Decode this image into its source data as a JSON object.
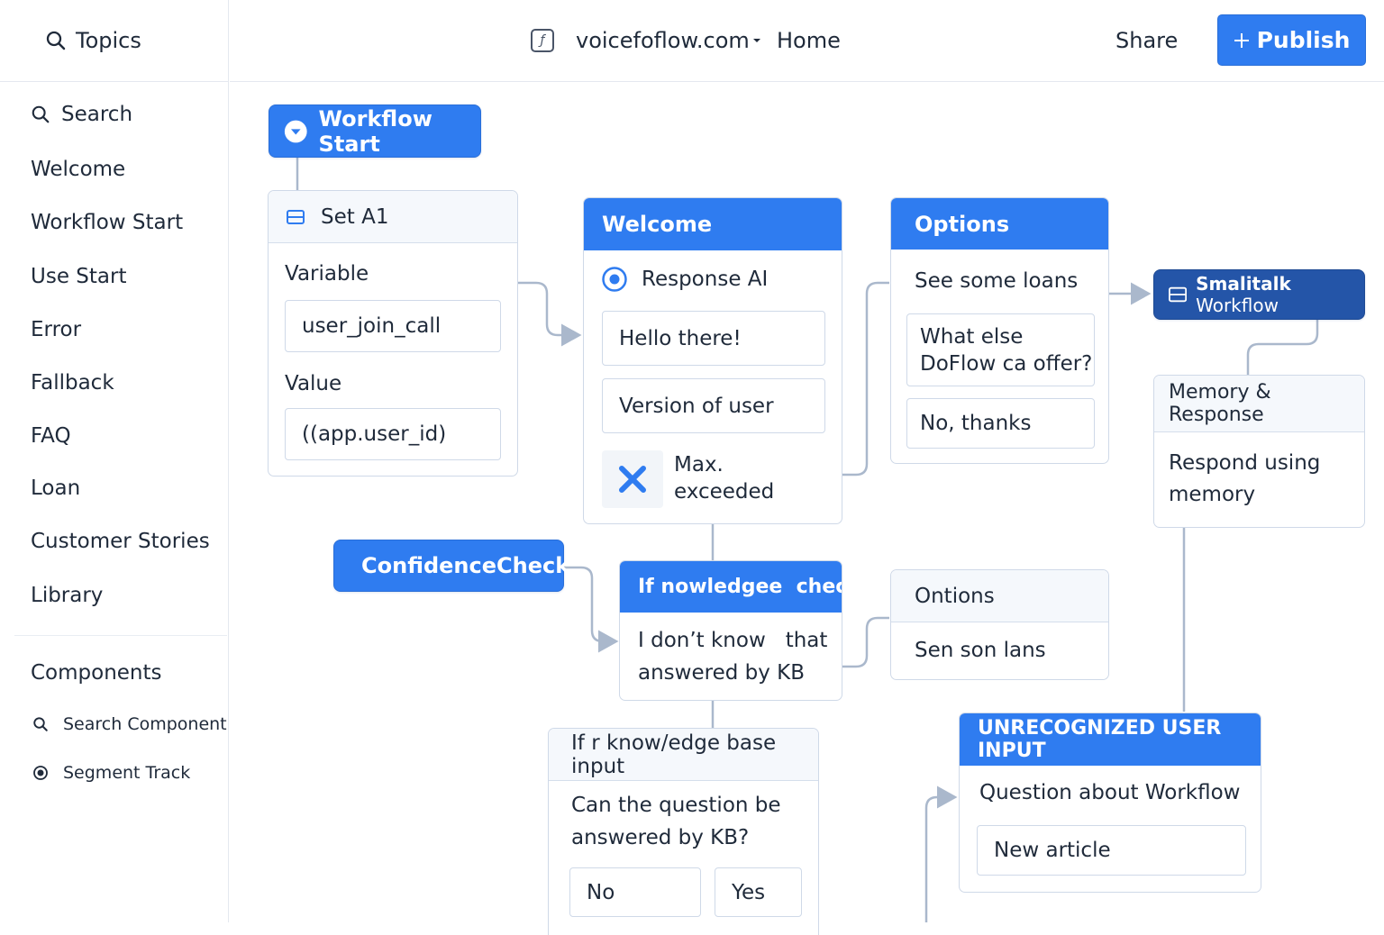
{
  "sidebar": {
    "header_label": "Topics",
    "items": [
      {
        "label": "Search"
      },
      {
        "label": "Welcome"
      },
      {
        "label": "Workflow Start"
      },
      {
        "label": "Use Start"
      },
      {
        "label": "Error"
      },
      {
        "label": "Fallback"
      },
      {
        "label": "FAQ"
      },
      {
        "label": "Loan"
      },
      {
        "label": "Customer Stories"
      },
      {
        "label": "Library"
      }
    ],
    "components_heading": "Components",
    "components": [
      {
        "label": "Search Component",
        "icon": "search-icon"
      },
      {
        "label": "Segment Track",
        "icon": "radio-dot-icon"
      }
    ]
  },
  "topbar": {
    "site": "voicefoflow.com",
    "page": "Home",
    "share_label": "Share",
    "publish_label": "Publish"
  },
  "canvas": {
    "workflow_start": {
      "label": "Workflow Start"
    },
    "set_a1": {
      "title": "Set A1",
      "variable_label": "Variable",
      "variable_value": "user_join_call",
      "value_label": "Value",
      "value_value": "((app.user_id)"
    },
    "welcome": {
      "title": "Welcome",
      "response_label": "Response AI",
      "messages": [
        "Hello there!",
        "Version of user"
      ],
      "error_label_1": "Max.",
      "error_label_2": "exceeded"
    },
    "options": {
      "title": "Options",
      "intro": "See some loans",
      "choice1_line1": "What else",
      "choice1_line2": "DoFlow ca offer?",
      "choice2": "No, thanks"
    },
    "smalltalk": {
      "bold": "Smalitalk",
      "rest": "Workflow"
    },
    "memory": {
      "title": "Memory & Response",
      "body_line1": "Respond using",
      "body_line2": "memory"
    },
    "confidence": {
      "label": "ConfidenceCheck"
    },
    "knowledge_check": {
      "title": "If nowledgee  check",
      "body_line1": "I don’t know   that",
      "body_line2": "answered by KB"
    },
    "ontions": {
      "title": "Ontions",
      "item": "Sen son lans"
    },
    "kb_input": {
      "title": "If r know/edge base input",
      "question_line1": "Can the question be",
      "question_line2": "answered by KB?",
      "no_label": "No",
      "yes_label": "Yes"
    },
    "unrecognized": {
      "title": "UNRECOGNIZED USER INPUT",
      "subtitle": "Question about Workflow",
      "item": "New article"
    }
  },
  "colors": {
    "accent": "#2f7cf0",
    "dark_accent": "#2455a8",
    "connector": "#aab8cc",
    "error_x": "#2f7cf0"
  }
}
